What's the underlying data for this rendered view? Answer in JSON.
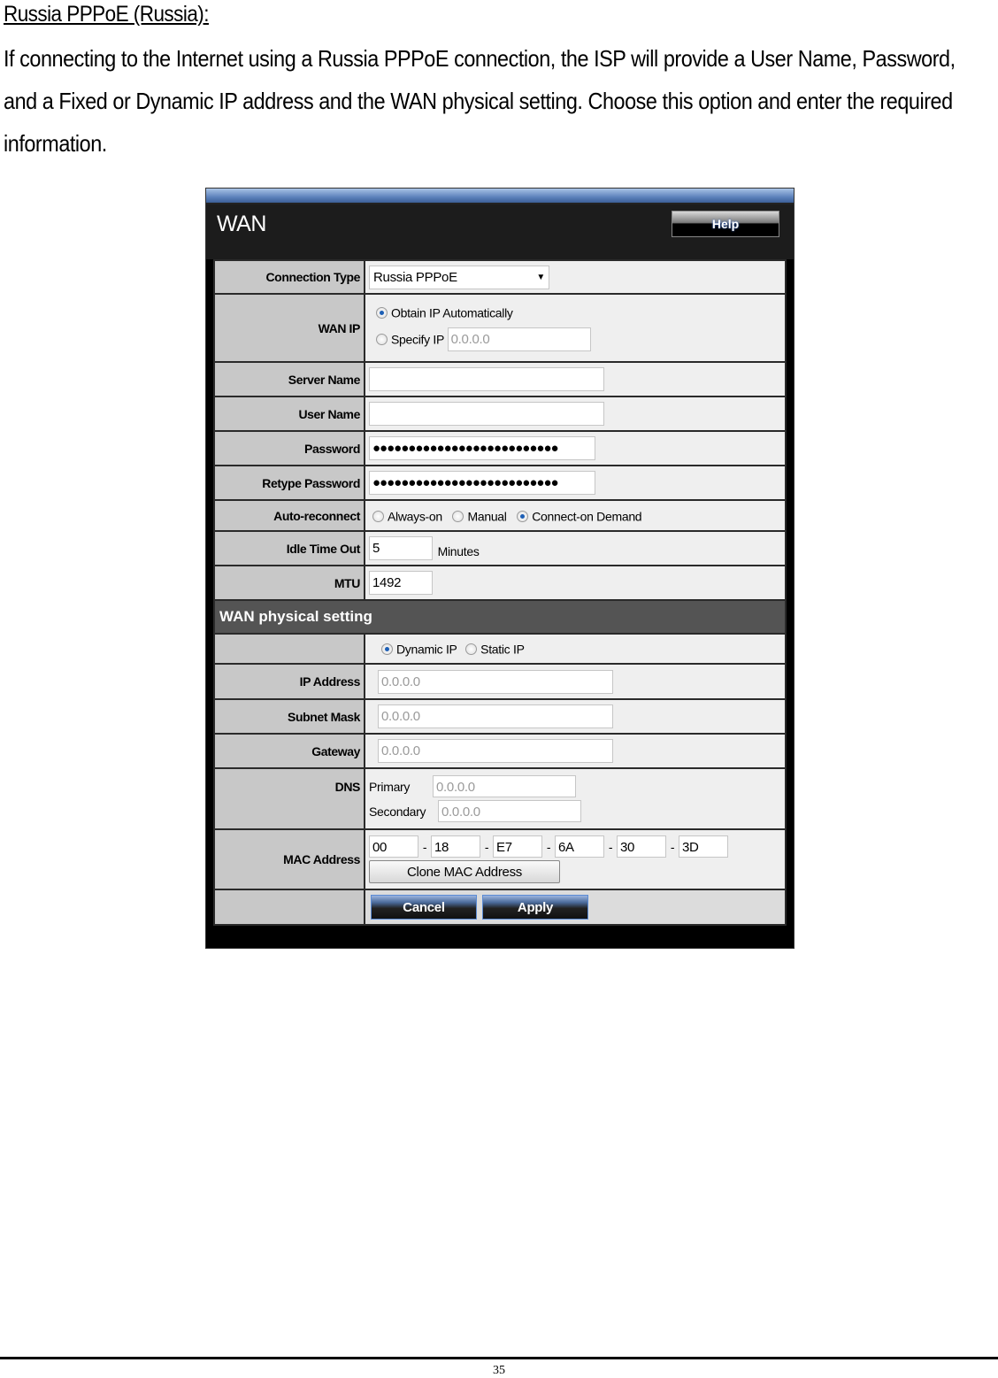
{
  "document": {
    "heading": "Russia PPPoE (Russia):",
    "paragraph": "If connecting to the Internet using a Russia PPPoE connection, the ISP will provide a User Name, Password, and a Fixed or Dynamic IP address and the WAN physical setting. Choose this option and enter the required information.",
    "page_number": "35"
  },
  "panel": {
    "title": "WAN",
    "help_label": "Help",
    "connection_type": {
      "label": "Connection Type",
      "value": "Russia PPPoE"
    },
    "wan_ip": {
      "label": "WAN IP",
      "obtain_label": "Obtain IP Automatically",
      "obtain_selected": true,
      "specify_label": "Specify IP",
      "specify_value": "0.0.0.0"
    },
    "server_name": {
      "label": "Server Name",
      "value": ""
    },
    "user_name": {
      "label": "User Name",
      "value": ""
    },
    "password": {
      "label": "Password",
      "value": "●●●●●●●●●●●●●●●●●●●●●●●●●●"
    },
    "retype_password": {
      "label": "Retype Password",
      "value": "●●●●●●●●●●●●●●●●●●●●●●●●●●"
    },
    "auto_reconnect": {
      "label": "Auto-reconnect",
      "options": [
        "Always-on",
        "Manual",
        "Connect-on Demand"
      ],
      "selected": "Connect-on Demand"
    },
    "idle_time_out": {
      "label": "Idle Time Out",
      "value": "5",
      "unit": "Minutes"
    },
    "mtu": {
      "label": "MTU",
      "value": "1492"
    },
    "physical": {
      "section_title": "WAN physical setting",
      "mode_options": [
        "Dynamic IP",
        "Static IP"
      ],
      "mode_selected": "Dynamic IP",
      "ip_address": {
        "label": "IP Address",
        "value": "0.0.0.0"
      },
      "subnet_mask": {
        "label": "Subnet Mask",
        "value": "0.0.0.0"
      },
      "gateway": {
        "label": "Gateway",
        "value": "0.0.0.0"
      },
      "dns": {
        "label": "DNS",
        "primary_label": "Primary",
        "primary_value": "0.0.0.0",
        "secondary_label": "Secondary",
        "secondary_value": "0.0.0.0"
      },
      "mac_address": {
        "label": "MAC Address",
        "octets": [
          "00",
          "18",
          "E7",
          "6A",
          "30",
          "3D"
        ],
        "separator": "-",
        "clone_label": "Clone MAC Address"
      }
    },
    "cancel_label": "Cancel",
    "apply_label": "Apply"
  }
}
